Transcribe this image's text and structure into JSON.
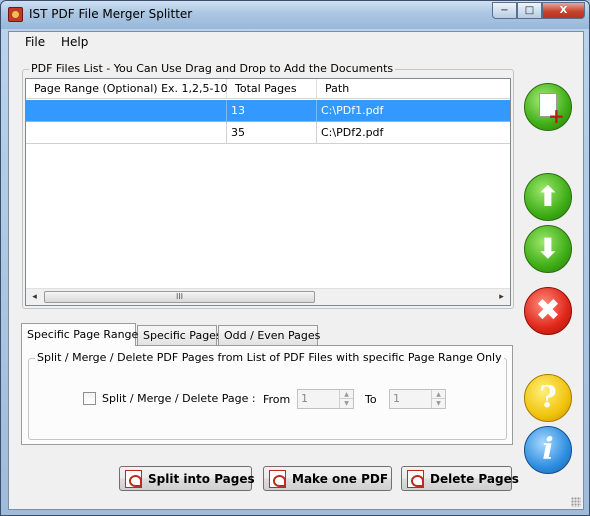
{
  "window": {
    "title": "IST PDF File Merger Splitter",
    "minimize_glyph": "−",
    "maximize_glyph": "□",
    "close_glyph": "X"
  },
  "menu": {
    "file": "File",
    "help": "Help"
  },
  "files_list": {
    "caption": "PDF Files List - You Can Use Drag and Drop to Add the Documents",
    "columns": [
      "Page Range (Optional) Ex. 1,2,5-10",
      "Total Pages",
      "Path"
    ],
    "rows": [
      {
        "page_range": "",
        "total_pages": "13",
        "path": "C:\\PDf1.pdf",
        "selected": true
      },
      {
        "page_range": "",
        "total_pages": "35",
        "path": "C:\\PDf2.pdf",
        "selected": false
      }
    ],
    "scroll_left": "◂",
    "scroll_right": "▸",
    "scroll_thumb_grip": "III"
  },
  "side_buttons": {
    "add_plus": "+",
    "up_arrow": "⬆",
    "down_arrow": "⬇",
    "delete_x": "✖",
    "help_q": "?",
    "info_i": "i"
  },
  "tabs": [
    "Specific Page Range",
    "Specific Pages",
    "Odd / Even Pages"
  ],
  "active_tab": 0,
  "page_range_panel": {
    "caption": "Split / Merge / Delete PDF Pages from List of PDF Files with specific Page Range Only",
    "checkbox_label": "Split / Merge / Delete Page :",
    "checkbox_checked": false,
    "from_label": "From",
    "from_value": "1",
    "to_label": "To",
    "to_value": "1",
    "spin_up": "▲",
    "spin_down": "▼"
  },
  "actions": {
    "split": "Split into Pages",
    "make": "Make one PDF",
    "delete": "Delete Pages"
  },
  "colors": {
    "selection": "#3399ff",
    "green_button": "#3fae16",
    "red_button": "#e0261a",
    "yellow_button": "#f1c40f",
    "blue_button": "#2f8ee0"
  }
}
